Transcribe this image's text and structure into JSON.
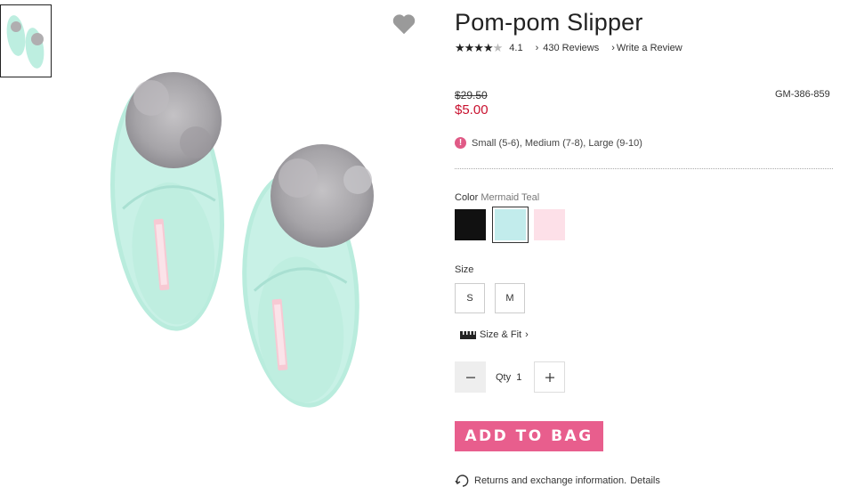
{
  "product": {
    "title": "Pom-pom Slipper",
    "rating_value": "4.1",
    "rating_stars": 4,
    "reviews_link": "430 Reviews",
    "write_review_link": "Write a Review",
    "old_price": "$29.50",
    "new_price": "$5.00",
    "sku": "GM-386-859",
    "size_notice": "Small (5-6), Medium (7-8), Large (9-10)"
  },
  "color": {
    "label": "Color",
    "selected_name": "Mermaid Teal",
    "swatches": [
      {
        "name": "black",
        "hex": "#111111"
      },
      {
        "name": "mermaid-teal",
        "hex": "#c2ecec"
      },
      {
        "name": "pink",
        "hex": "#fde0e8"
      }
    ]
  },
  "size": {
    "label": "Size",
    "options": [
      "S",
      "M"
    ],
    "size_fit_link": "Size & Fit"
  },
  "quantity": {
    "label": "Qty",
    "value": "1"
  },
  "cart": {
    "add_to_bag": "ADD TO BAG"
  },
  "returns": {
    "text": "Returns and exchange information.",
    "link": "Details"
  },
  "colors": {
    "accent_pink": "#e85e8d",
    "sale_red": "#c8102e",
    "product_mint": "#bdeee0",
    "pompom_gray": "#a9a9ab"
  }
}
